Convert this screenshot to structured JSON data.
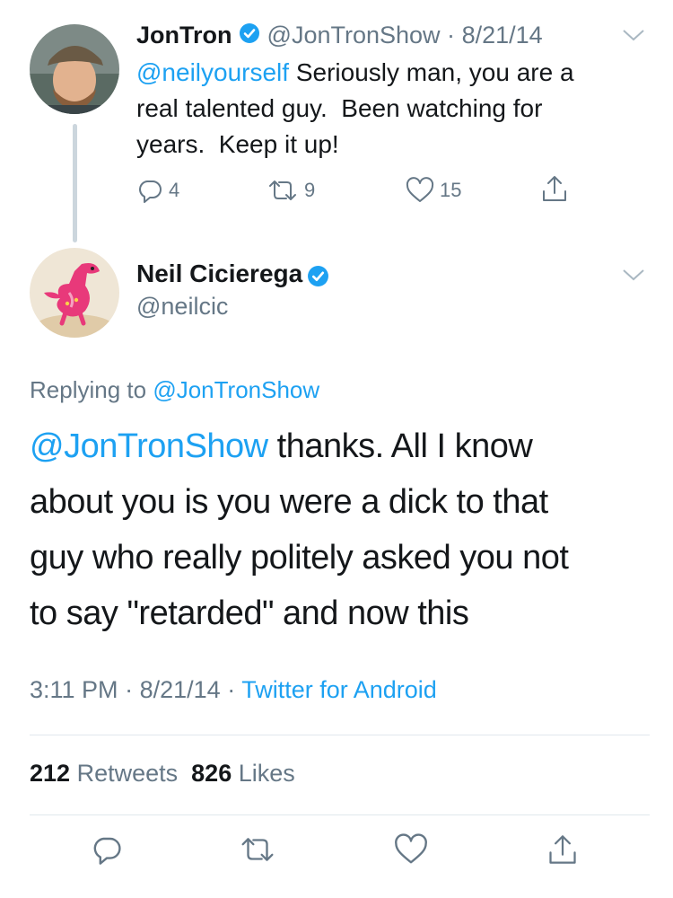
{
  "tweet1": {
    "author_name": "JonTron",
    "author_handle": "@JonTronShow",
    "sep": "·",
    "date": "8/21/14",
    "mention": "@neilyourself",
    "text_line1": "Seriously man, you are a",
    "text_line2": "real talented guy.  Been watching for",
    "text_line3": "years.  Keep it up!",
    "replies": "4",
    "retweets": "9",
    "likes": "15"
  },
  "tweet2": {
    "author_name": "Neil Cicierega",
    "author_handle": "@neilcic",
    "replying_prefix": "Replying to ",
    "replying_to": "@JonTronShow",
    "mention": "@JonTronShow",
    "text_line1_rest": " thanks. All I know",
    "text_line2": "about you is you were a dick to that",
    "text_line3": "guy who really politely asked you not",
    "text_line4": "to say \"retarded\" and now this",
    "time": "3:11 PM",
    "sep1": "·",
    "date": "8/21/14",
    "sep2": "·",
    "source": "Twitter for Android",
    "retweet_count": "212",
    "retweet_label": "Retweets",
    "like_count": "826",
    "like_label": "Likes"
  },
  "colors": {
    "accent": "#1da1f2",
    "muted": "#657786",
    "text": "#14171a",
    "divider": "#e1e8ed",
    "thread_line": "#ccd6dd"
  }
}
